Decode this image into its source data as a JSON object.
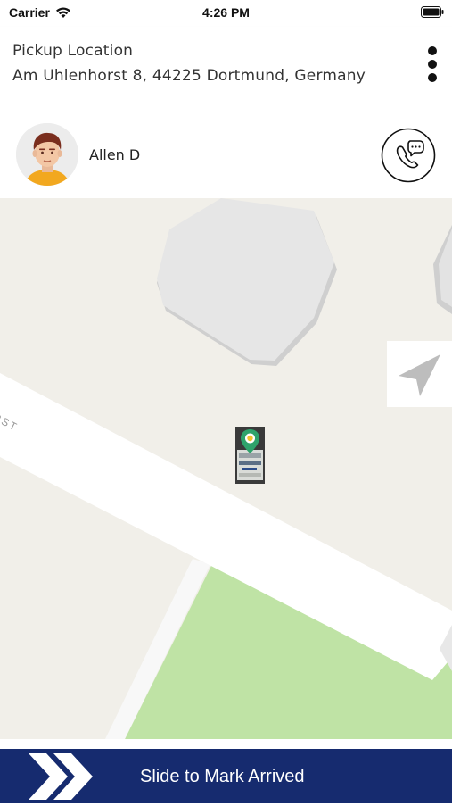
{
  "status_bar": {
    "carrier": "Carrier",
    "time": "4:26 PM"
  },
  "header": {
    "pickup_label": "Pickup Location",
    "pickup_address": "Am Uhlenhorst 8, 44225 Dortmund, Germany",
    "menu_icon": "more-vertical-icon"
  },
  "driver": {
    "name": "Allen D",
    "avatar_icon": "driver-avatar",
    "call_icon": "phone-chat-icon"
  },
  "map": {
    "street_label": "RST",
    "locate_icon": "navigation-arrow-icon",
    "marker_icon": "car-location-marker-icon",
    "colors": {
      "land": "#f1efe9",
      "building": "#e6e6e6",
      "road": "#ffffff",
      "park": "#bfe3a5",
      "marker": "#2ea36b"
    }
  },
  "slider": {
    "label": "Slide to Mark Arrived",
    "handle_icon": "double-chevron-right-icon",
    "color": "#162b6f"
  }
}
